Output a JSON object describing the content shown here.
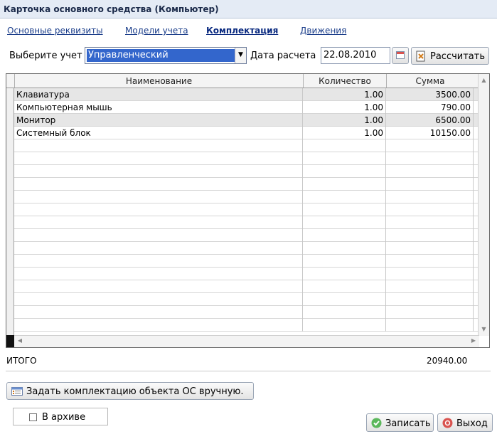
{
  "window": {
    "title": "Карточка основного средства (Компьютер)"
  },
  "tabs": [
    {
      "label": "Основные реквизиты",
      "active": false
    },
    {
      "label": "Модели учета",
      "active": false
    },
    {
      "label": "Комплектация",
      "active": true
    },
    {
      "label": "Движения",
      "active": false
    }
  ],
  "toolbar": {
    "select_label": "Выберите учет",
    "select_value": "Управленческий",
    "date_label": "Дата расчета",
    "date_value": "22.08.2010",
    "calc_button": "Рассчитать"
  },
  "grid": {
    "columns": [
      "Наименование",
      "Количество",
      "Сумма"
    ],
    "rows": [
      {
        "name": "Клавиатура",
        "qty": "1.00",
        "sum": "3500.00"
      },
      {
        "name": "Компьютерная мышь",
        "qty": "1.00",
        "sum": "790.00"
      },
      {
        "name": "Монитор",
        "qty": "1.00",
        "sum": "6500.00"
      },
      {
        "name": "Системный блок",
        "qty": "1.00",
        "sum": "10150.00"
      }
    ]
  },
  "total": {
    "label": "ИТОГО",
    "value": "20940.00"
  },
  "manual_button": "Задать комплектацию объекта ОС вручную.",
  "archive": {
    "label": "В архиве",
    "checked": false
  },
  "footer": {
    "save_label": "Записать",
    "exit_label": "Выход"
  },
  "colors": {
    "accent": "#3366cc",
    "title_bg": "#e4ebf5",
    "alt_row": "#e6e6e6"
  }
}
